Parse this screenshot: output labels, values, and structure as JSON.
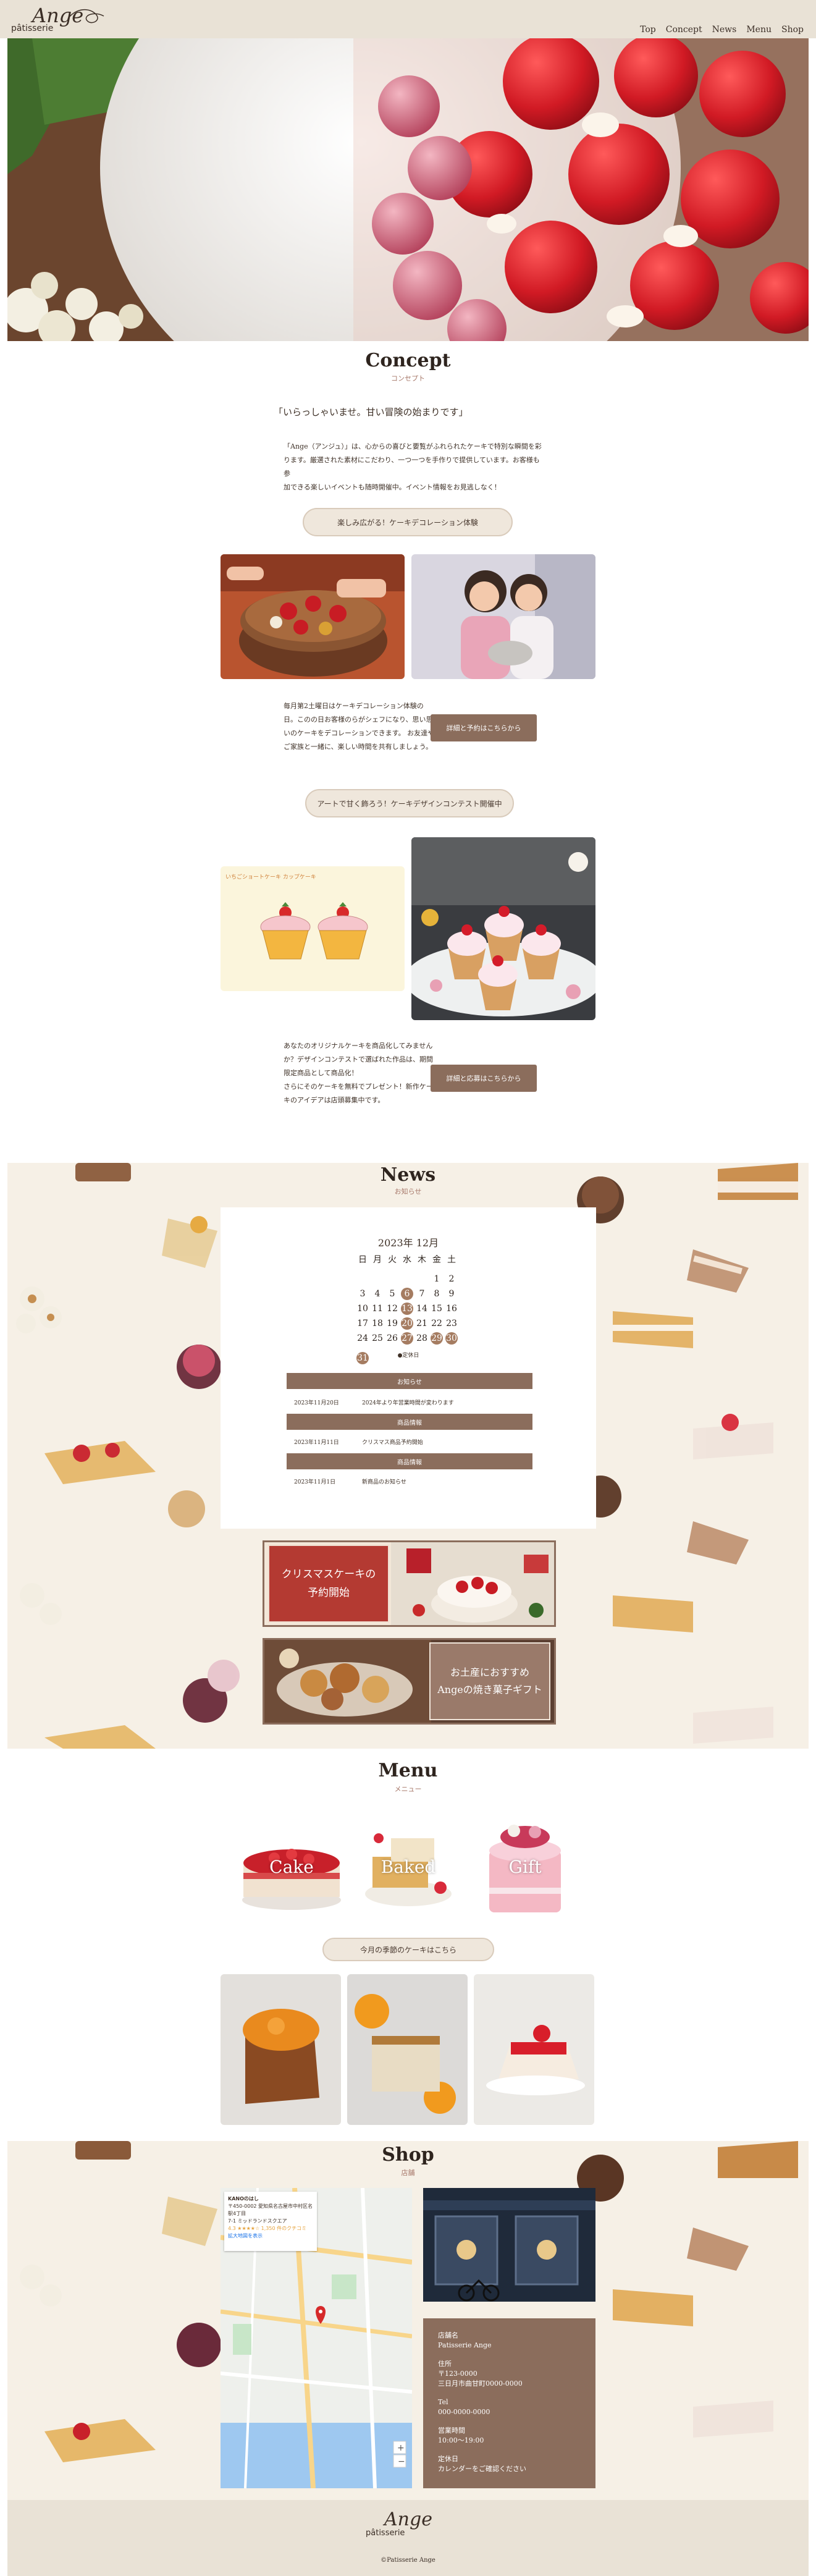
{
  "header": {
    "logo_main": "Ange",
    "logo_sub": "pâtisserie",
    "nav": [
      "Top",
      "Concept",
      "News",
      "Menu",
      "Shop"
    ]
  },
  "concept": {
    "title": "Concept",
    "subtitle": "コンセプト",
    "lead": "「いらっしゃいませ。甘い冒険の始まりです」",
    "body": [
      "「Ange（アンジュ）」は、心からの喜びと要覧がふれられたケーキで特別な瞬間を彩",
      "ります。厳選された素材にこだわり、一つ一つを手作りで提供しています。お客様も参",
      "加できる楽しいイベントも随時開催中。イベント情報をお見逃しなく！"
    ],
    "event1": {
      "pill": "楽しみ広がる！ケーキデコレーション体験",
      "text": [
        "毎月第2土曜日はケーキデコレーション体験の",
        "日。このの日お客様のらがシェフになり、思い思",
        "いのケーキをデコレーションできます。 お友達や",
        "ご家族と一緒に、楽しい時間を共有しましょう。"
      ],
      "button": "詳細と予約はこちらから"
    },
    "event2": {
      "pill": "アートで甘く飾ろう！ケーキデザインコンテスト開催中",
      "sketch_title": "いちごショートケーキ カップケーキ",
      "text": [
        "あなたのオリジナルケーキを商品化してみません",
        "か？デザインコンテストで選ばれた作品は、期間",
        "限定商品として商品化！",
        "さらにそのケーキを無料でプレゼント！新作ケー",
        "キのアイデアは店頭募集中です。"
      ],
      "button": "詳細と応募はこちらから"
    }
  },
  "news": {
    "title": "News",
    "subtitle": "お知らせ",
    "calendar": {
      "month": "2023年 12月",
      "weekdays": [
        "日",
        "月",
        "火",
        "水",
        "木",
        "金",
        "土"
      ],
      "weeks": [
        [
          "",
          "",
          "",
          "",
          "",
          "1",
          "2"
        ],
        [
          "3",
          "4",
          "5",
          "6",
          "7",
          "8",
          "9"
        ],
        [
          "10",
          "11",
          "12",
          "13",
          "14",
          "15",
          "16"
        ],
        [
          "17",
          "18",
          "19",
          "20",
          "21",
          "22",
          "23"
        ],
        [
          "24",
          "25",
          "26",
          "27",
          "28",
          "29",
          "30"
        ],
        [
          "31",
          "",
          "",
          "",
          "",
          "",
          ""
        ]
      ],
      "event_days": [
        "6",
        "13",
        "20",
        "27",
        "29",
        "30",
        "31"
      ],
      "legend": "●定休日"
    },
    "sections": [
      {
        "header": "お知らせ",
        "items": [
          {
            "date": "2023年11月20日",
            "text": "2024年より年営業時間が変わります"
          }
        ]
      },
      {
        "header": "商品情報",
        "items": [
          {
            "date": "2023年11月11日",
            "text": "クリスマス商品予約開始"
          }
        ]
      },
      {
        "header": "商品情報",
        "items": [
          {
            "date": "2023年11月1日",
            "text": "新商品のお知らせ"
          }
        ]
      }
    ],
    "banner1": [
      "クリスマスケーキの",
      "予約開始"
    ],
    "banner2": [
      "お土産におすすめ",
      "Angeの焼き菓子ギフト"
    ]
  },
  "menu": {
    "title": "Menu",
    "subtitle": "メニュー",
    "categories": [
      "Cake",
      "Baked",
      "Gift"
    ],
    "pill": "今月の季節のケーキはこちら"
  },
  "shop": {
    "title": "Shop",
    "subtitle": "店舗",
    "map_card": [
      "KANOのはし",
      "〒450-0002 愛知県名古屋市中村区名駅4丁目",
      "7-1 ミッドランドスクエア",
      "4.3 ★★★★☆ 1,350 件のクチコミ",
      "拡大地図を表示"
    ],
    "info": [
      {
        "label": "店舗名",
        "value": "Patisserie Ange"
      },
      {
        "label": "住所",
        "value": "〒123-0000\n三日月市曲甘町0000-0000"
      },
      {
        "label": "Tel",
        "value": "000-0000-0000"
      },
      {
        "label": "営業時間",
        "value": "10:00〜19:00"
      },
      {
        "label": "定休日",
        "value": "カレンダーをご確認ください"
      }
    ]
  },
  "footer": {
    "logo_main": "Ange",
    "logo_sub": "pâtisserie",
    "copyright": "©Patisserie Ange"
  },
  "colors": {
    "header_bg": "#e9e2d6",
    "beige_section": "#f6f0e6",
    "brown_accent": "#8b6d5c",
    "christmas_red": "#b43a32"
  }
}
